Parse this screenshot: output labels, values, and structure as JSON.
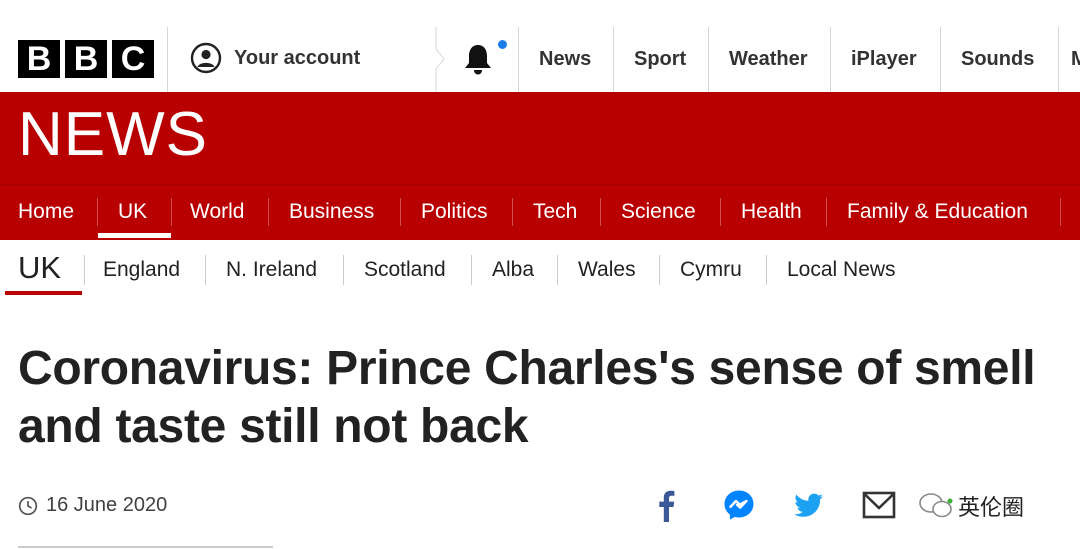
{
  "brand": {
    "logo_letters": [
      "B",
      "B",
      "C"
    ]
  },
  "account": {
    "label": "Your account"
  },
  "top_nav": [
    {
      "label": "News"
    },
    {
      "label": "Sport"
    },
    {
      "label": "Weather"
    },
    {
      "label": "iPlayer"
    },
    {
      "label": "Sounds"
    }
  ],
  "news_banner": {
    "wordmark": "NEWS"
  },
  "section_nav": {
    "active": "UK",
    "items": [
      {
        "label": "Home"
      },
      {
        "label": "UK"
      },
      {
        "label": "World"
      },
      {
        "label": "Business"
      },
      {
        "label": "Politics"
      },
      {
        "label": "Tech"
      },
      {
        "label": "Science"
      },
      {
        "label": "Health"
      },
      {
        "label": "Family & Education"
      }
    ]
  },
  "sub_nav": {
    "current": "UK",
    "items": [
      {
        "label": "England"
      },
      {
        "label": "N. Ireland"
      },
      {
        "label": "Scotland"
      },
      {
        "label": "Alba"
      },
      {
        "label": "Wales"
      },
      {
        "label": "Cymru"
      },
      {
        "label": "Local News"
      }
    ]
  },
  "article": {
    "headline": "Coronavirus: Prince Charles's sense of smell and taste still not back",
    "date": "16 June 2020"
  },
  "share": {
    "icons": [
      "facebook-icon",
      "messenger-icon",
      "twitter-icon",
      "email-icon"
    ]
  },
  "watermark": {
    "text": "英伦圈"
  },
  "colors": {
    "brand_red": "#b80000",
    "facebook": "#3b5998",
    "messenger": "#0084ff",
    "twitter": "#1da1f2",
    "notification_dot": "#1b7ee8"
  }
}
